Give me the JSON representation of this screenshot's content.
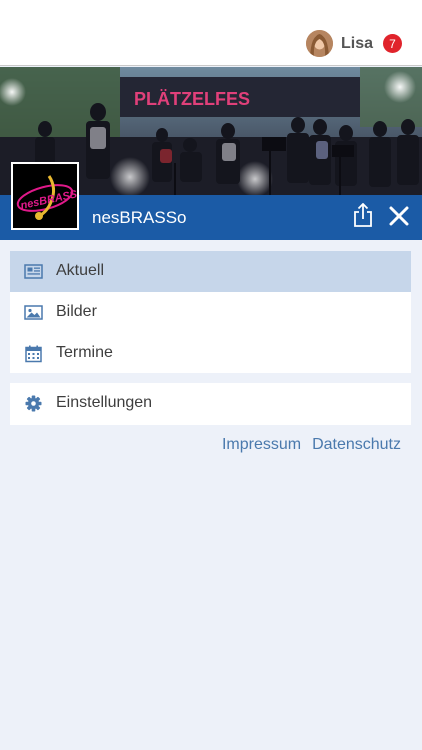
{
  "header": {
    "user_name": "Lisa",
    "notification_count": "7"
  },
  "banner": {
    "stage_sign": "PLÄTZELFES"
  },
  "group": {
    "name": "nesBRASSo",
    "logo_text": "nesBRASSo"
  },
  "menu": {
    "items": [
      {
        "label": "Aktuell",
        "icon": "newspaper-icon",
        "active": true
      },
      {
        "label": "Bilder",
        "icon": "image-icon",
        "active": false
      },
      {
        "label": "Termine",
        "icon": "calendar-icon",
        "active": false
      }
    ],
    "settings": {
      "label": "Einstellungen",
      "icon": "gear-icon"
    }
  },
  "footer": {
    "impressum": "Impressum",
    "datenschutz": "Datenschutz"
  },
  "colors": {
    "brand_blue": "#1b5ba6",
    "active_row": "#c6d6ea",
    "link": "#4a79ad",
    "badge": "#e0232b",
    "page_bg": "#edf1f9"
  }
}
